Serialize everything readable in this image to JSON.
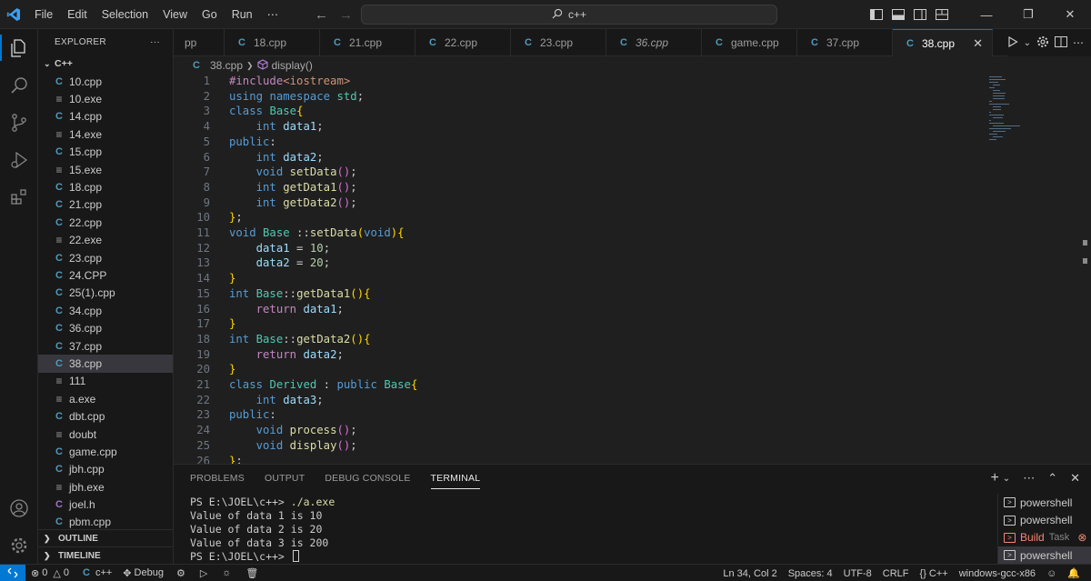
{
  "menu": [
    "File",
    "Edit",
    "Selection",
    "View",
    "Go",
    "Run",
    "⋯"
  ],
  "command_center": "c++",
  "window_buttons": [
    "—",
    "❐",
    "✕"
  ],
  "sidebar": {
    "title": "EXPLORER",
    "more": "···",
    "folder": "C++",
    "files": [
      {
        "name": "10.cpp",
        "type": "cpp"
      },
      {
        "name": "10.exe",
        "type": "exe"
      },
      {
        "name": "14.cpp",
        "type": "cpp"
      },
      {
        "name": "14.exe",
        "type": "exe"
      },
      {
        "name": "15.cpp",
        "type": "cpp"
      },
      {
        "name": "15.exe",
        "type": "exe"
      },
      {
        "name": "18.cpp",
        "type": "cpp"
      },
      {
        "name": "21.cpp",
        "type": "cpp"
      },
      {
        "name": "22.cpp",
        "type": "cpp"
      },
      {
        "name": "22.exe",
        "type": "exe"
      },
      {
        "name": "23.cpp",
        "type": "cpp"
      },
      {
        "name": "24.CPP",
        "type": "cpp"
      },
      {
        "name": "25(1).cpp",
        "type": "cpp"
      },
      {
        "name": "34.cpp",
        "type": "cpp"
      },
      {
        "name": "36.cpp",
        "type": "cpp"
      },
      {
        "name": "37.cpp",
        "type": "cpp"
      },
      {
        "name": "38.cpp",
        "type": "cpp",
        "selected": true
      },
      {
        "name": "111",
        "type": "exe"
      },
      {
        "name": "a.exe",
        "type": "exe"
      },
      {
        "name": "dbt.cpp",
        "type": "cpp"
      },
      {
        "name": "doubt",
        "type": "exe"
      },
      {
        "name": "game.cpp",
        "type": "cpp"
      },
      {
        "name": "jbh.cpp",
        "type": "cpp"
      },
      {
        "name": "jbh.exe",
        "type": "exe"
      },
      {
        "name": "joel.h",
        "type": "h"
      },
      {
        "name": "pbm.cpp",
        "type": "cpp"
      }
    ],
    "outline": "OUTLINE",
    "timeline": "TIMELINE"
  },
  "tabs": [
    {
      "label": "pp",
      "partial": true
    },
    {
      "label": "18.cpp"
    },
    {
      "label": "21.cpp"
    },
    {
      "label": "22.cpp"
    },
    {
      "label": "23.cpp"
    },
    {
      "label": "36.cpp",
      "italic": true
    },
    {
      "label": "game.cpp"
    },
    {
      "label": "37.cpp"
    },
    {
      "label": "38.cpp",
      "active": true
    }
  ],
  "breadcrumb": {
    "file": "38.cpp",
    "symbol": "display()"
  },
  "editor": {
    "line_numbers": [
      "1",
      "2",
      "3",
      "4",
      "5",
      "6",
      "7",
      "8",
      "9",
      "10",
      "11",
      "12",
      "13",
      "14",
      "15",
      "16",
      "17",
      "18",
      "19",
      "20",
      "21",
      "22",
      "23",
      "24",
      "25",
      "26"
    ]
  },
  "panel": {
    "tabs": [
      "PROBLEMS",
      "OUTPUT",
      "DEBUG CONSOLE",
      "TERMINAL"
    ],
    "active_tab": "TERMINAL",
    "terminal_lines": [
      {
        "prompt": "PS E:\\JOEL\\c++> ",
        "cmd": "./a.exe"
      },
      {
        "text": "Value of data 1 is 10"
      },
      {
        "text": "Value of data 2 is 20"
      },
      {
        "text": "Value of data 3 is 200"
      },
      {
        "prompt": "PS E:\\JOEL\\c++> ",
        "cmd": ""
      }
    ],
    "terminals": [
      {
        "label": "powershell"
      },
      {
        "label": "powershell"
      },
      {
        "label": "Build",
        "task": "Task",
        "error": true
      },
      {
        "label": "powershell",
        "selected": true
      }
    ]
  },
  "statusbar": {
    "errors": "0",
    "warnings": "0",
    "lang_left": "c++",
    "debug": "Debug",
    "position": "Ln 34, Col 2",
    "spaces": "Spaces: 4",
    "encoding": "UTF-8",
    "eol": "CRLF",
    "language": "C++",
    "config": "windows-gcc-x86"
  },
  "colors": {
    "accent": "#0078d4",
    "cpp_icon": "#519aba",
    "keyword": "#569cd6",
    "function": "#dcdcaa",
    "type": "#4ec9b0"
  }
}
